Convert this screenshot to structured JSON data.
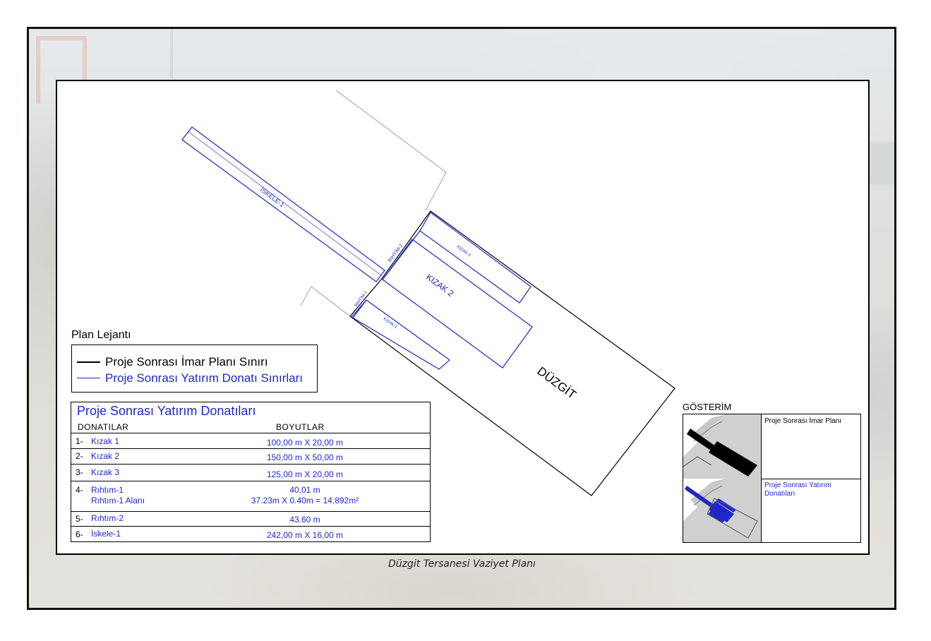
{
  "plan": {
    "labels": {
      "iskele1": "İSKELE-1",
      "rihtim2": "RIHTIM-2",
      "rihtim1": "RIHTIM-1",
      "kizak3": "KIZAK-3",
      "kizak2": "KIZAK 2",
      "kizak1": "KIZAK-1",
      "duzgit": "DÜZGİT"
    },
    "colors": {
      "plan_boundary": "#000000",
      "facility_boundary": "#1f27c8",
      "background_outline": "#b0b0b0"
    }
  },
  "legend": {
    "title": "Plan Lejantı",
    "items": [
      {
        "label": "Proje Sonrası İmar Planı Sınırı",
        "color": "#000000"
      },
      {
        "label": "Proje Sonrası Yatırım Donatı Sınırları",
        "color": "#1f27c8"
      }
    ]
  },
  "facilities": {
    "title": "Proje Sonrası Yatırım Donatıları",
    "col_name": "DONATILAR",
    "col_dim": "BOYUTLAR",
    "rows": [
      {
        "num": "1-",
        "name": "Kızak 1",
        "dim": "100,00 m X 20,00 m"
      },
      {
        "num": "2-",
        "name": "Kızak 2",
        "dim": "150,00 m X 50,00 m"
      },
      {
        "num": "3-",
        "name": "Kızak 3",
        "dim": "125,00 m X 20,00 m"
      },
      {
        "num": "4-",
        "name": "Rıhtım-1",
        "name2": "Rıhtım-1 Alanı",
        "dim": "40,01 m",
        "dim2": "37.23m X 0.40m = 14,892m²"
      },
      {
        "num": "5-",
        "name": "Rıhtım-2",
        "dim": "43.60 m"
      },
      {
        "num": "6-",
        "name": "İskele-1",
        "dim": "242,00 m X 16,00 m"
      }
    ]
  },
  "gosterim": {
    "title": "GÖSTERİM",
    "items": [
      {
        "label": "Proje Sonrası İmar Planı"
      },
      {
        "label": "Proje Sonrası Yatırım Donatıları"
      }
    ]
  },
  "caption": "Düzgit Tersanesi Vaziyet Planı"
}
